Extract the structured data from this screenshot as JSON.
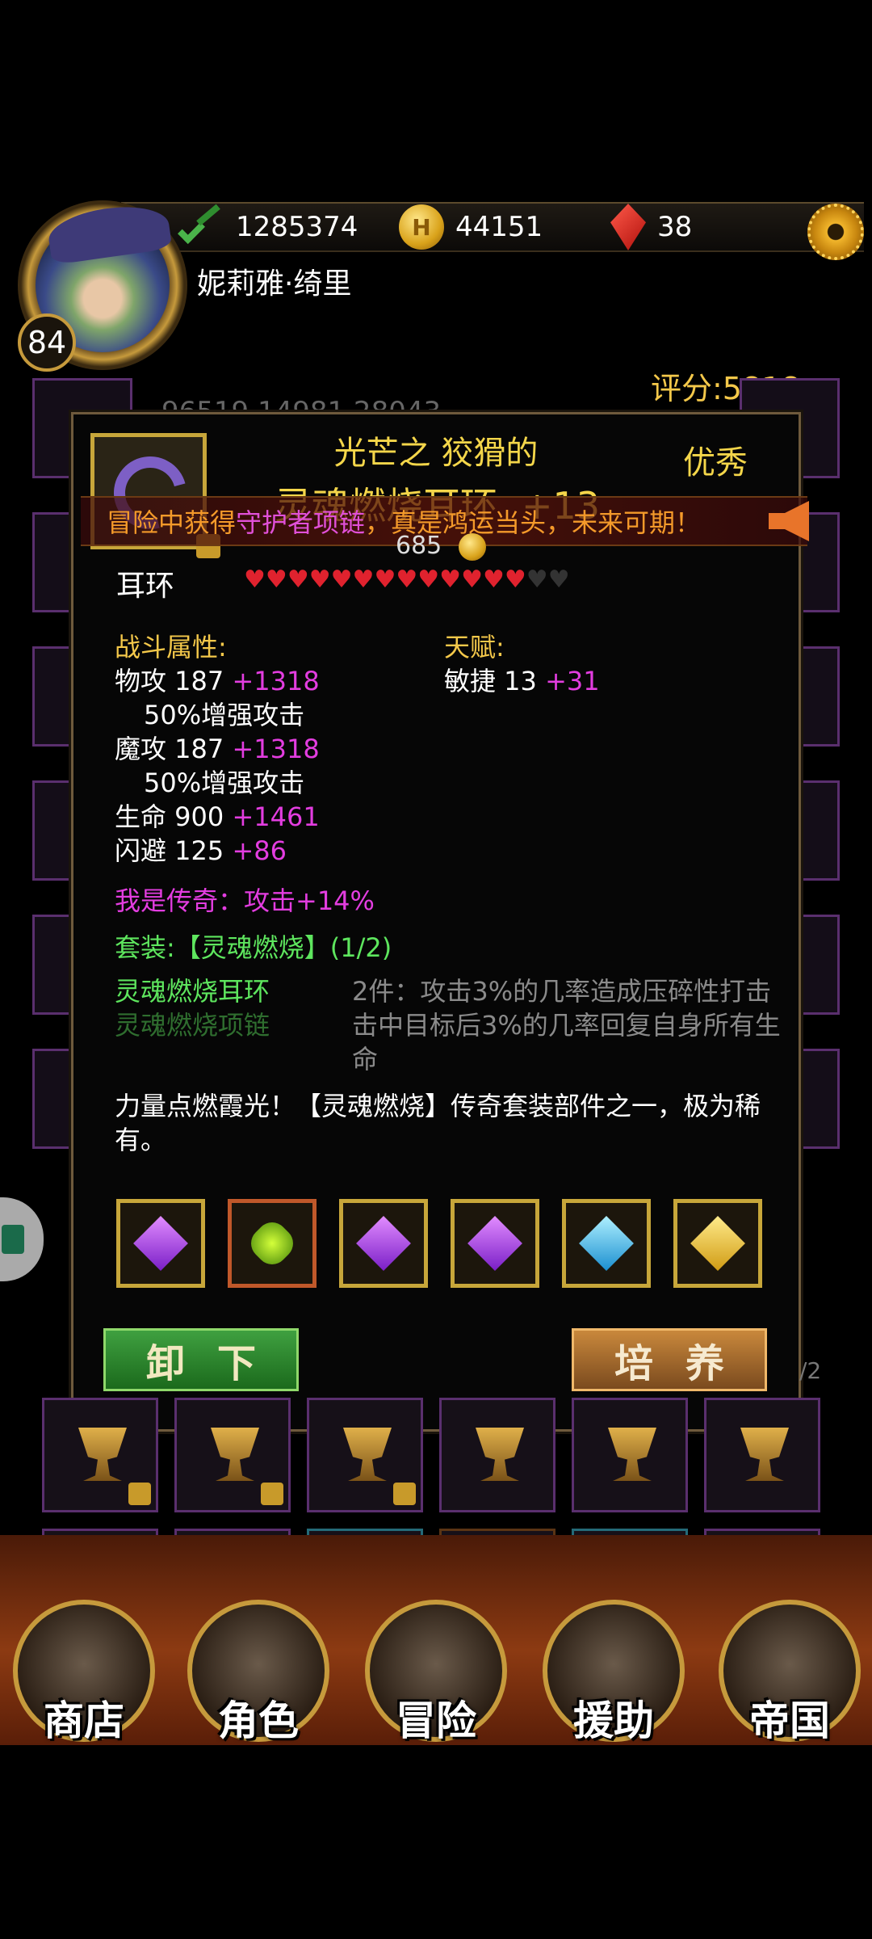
{
  "hud": {
    "exp": "1285374",
    "gold": "44151",
    "gold_icon_letter": "H",
    "gems": "38",
    "character_name": "妮莉雅·绮里",
    "level": "84",
    "score": "评分:5818"
  },
  "background_stats": "96519   14981   28043",
  "item": {
    "prefix": "光芒之  狡猾的",
    "name": "灵魂燃烧耳环",
    "enhance": "+13",
    "quality": "优秀",
    "price": "685",
    "slot_type": "耳环",
    "hearts_filled": 13,
    "hearts_total": 15,
    "combat_title": "战斗属性:",
    "combat_stats": [
      {
        "label": "物攻 187 ",
        "bonus": "+1318",
        "sub": "50%增强攻击"
      },
      {
        "label": "魔攻 187 ",
        "bonus": "+1318",
        "sub": "50%增强攻击"
      },
      {
        "label": "生命 900 ",
        "bonus": "+1461",
        "sub": ""
      },
      {
        "label": "闪避 125 ",
        "bonus": "+86",
        "sub": ""
      }
    ],
    "talent_title": "天赋:",
    "talent": {
      "label": "敏捷 13 ",
      "bonus": "+31"
    },
    "legendary": "我是传奇：攻击+14%",
    "set_title": "套装:【灵魂燃烧】(1/2)",
    "set_pieces": [
      {
        "name": "灵魂燃烧耳环",
        "owned": true
      },
      {
        "name": "灵魂燃烧项链",
        "owned": false
      }
    ],
    "set_bonus": "2件：攻击3%的几率造成压碎性打击击中目标后3%的几率回复自身所有生命",
    "flavor": "力量点燃霞光！【灵魂燃烧】传奇套装部件之一，极为稀有。",
    "gems": [
      "purple",
      "green",
      "purple",
      "purple",
      "blue",
      "yellow"
    ]
  },
  "marquee": {
    "part1": "冒险中获得",
    "highlight": "守护者项链",
    "part2": "，真是鸿运当头，未来可期！"
  },
  "buttons": {
    "unequip": "卸下",
    "train": "培养"
  },
  "page_hint": "/2",
  "nav": [
    {
      "label": "商店",
      "icon": "castle-icon"
    },
    {
      "label": "角色",
      "icon": "hooded-figure-icon"
    },
    {
      "label": "冒险",
      "icon": "dungeon-gate-icon"
    },
    {
      "label": "援助",
      "icon": "ally-portrait-icon"
    },
    {
      "label": "帝国",
      "icon": "crown-icon"
    }
  ]
}
